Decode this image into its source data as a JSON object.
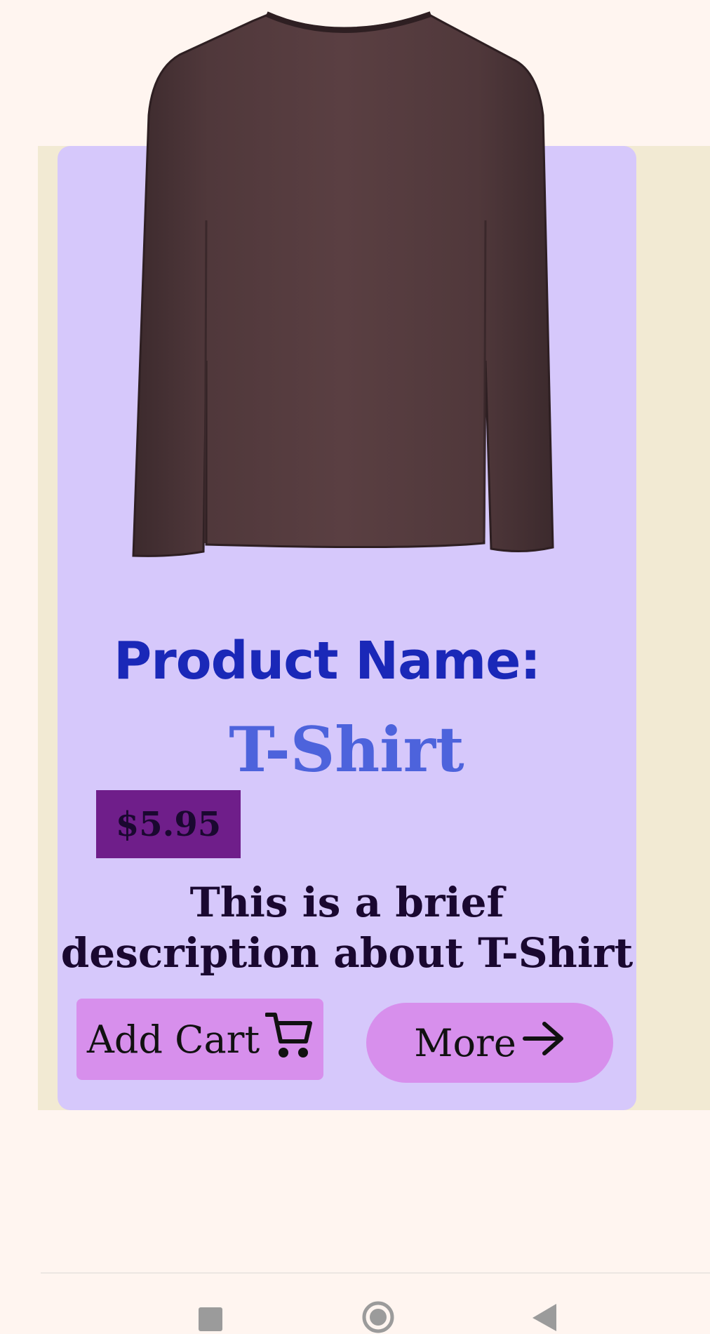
{
  "product": {
    "name_label": "Product Name:",
    "name": "T-Shirt",
    "price": "$5.95",
    "description": "This is a brief description about T-Shirt",
    "image_icon": "long-sleeve-shirt-image"
  },
  "actions": {
    "add_cart_label": "Add Cart",
    "add_cart_icon": "cart-icon",
    "more_label": "More",
    "more_icon": "arrow-right-icon"
  },
  "navbar": {
    "recents_icon": "square-icon",
    "home_icon": "circle-icon",
    "back_icon": "triangle-back-icon"
  },
  "colors": {
    "page_background": "#fff5f0",
    "backdrop": "#f2ead3",
    "card": "#d6c8fb",
    "name_label": "#1a28b8",
    "name_value": "#4d63dc",
    "price_badge": "#6f1e8a",
    "button": "#d78fec"
  }
}
